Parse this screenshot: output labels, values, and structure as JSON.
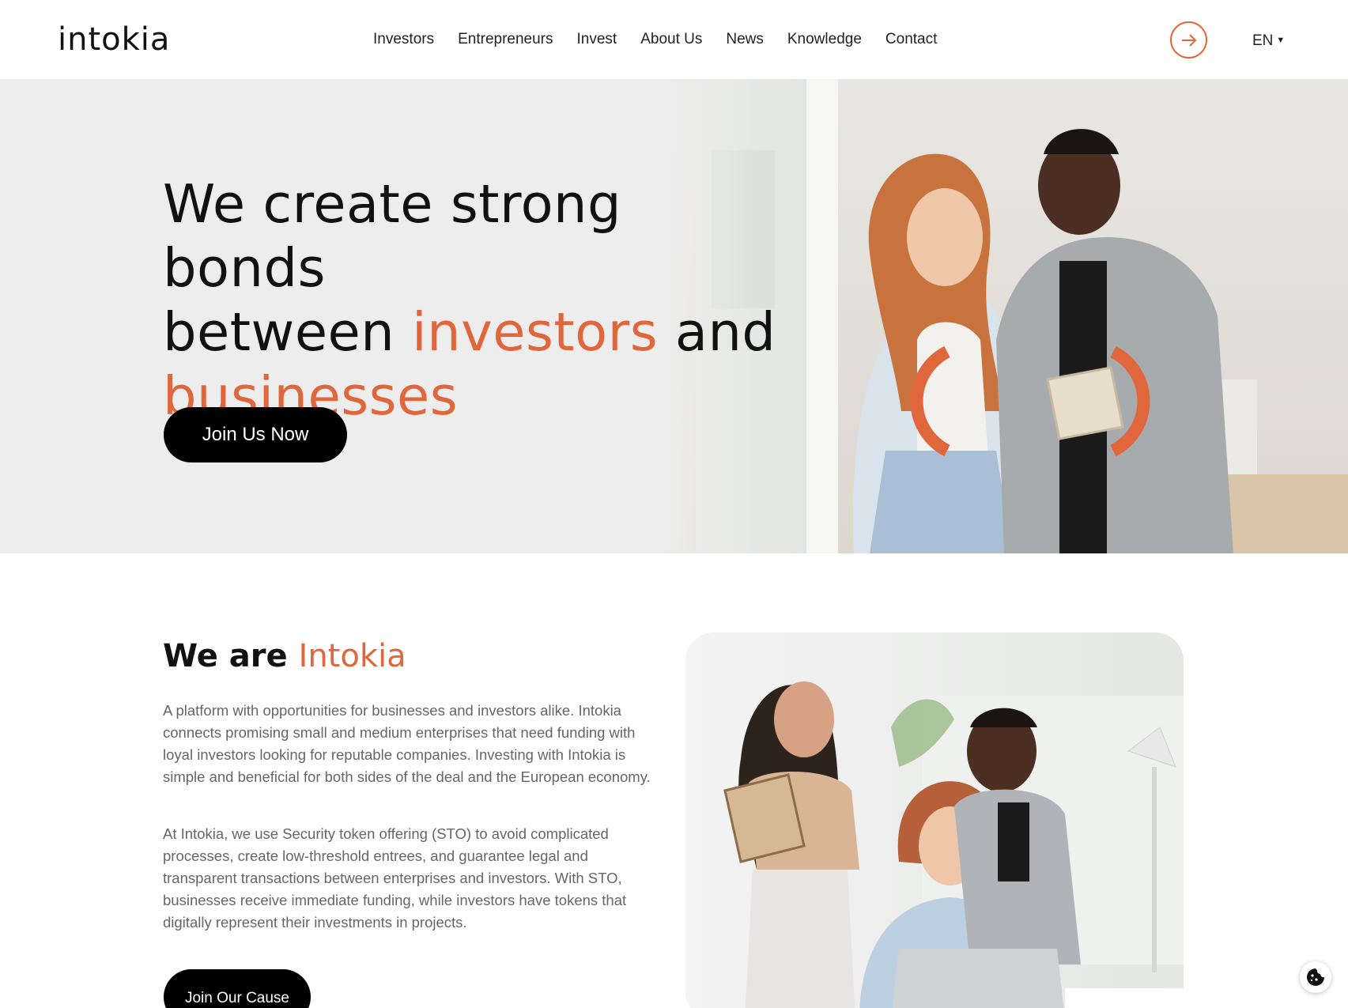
{
  "header": {
    "logo": "intokia",
    "nav": [
      "Investors",
      "Entrepreneurs",
      "Invest",
      "About Us",
      "News",
      "Knowledge",
      "Contact"
    ],
    "language": "EN",
    "login_icon": "arrow-right-circle-icon"
  },
  "hero": {
    "title_line1": "We create strong bonds",
    "title_line2_a": "between ",
    "title_line2_accent": "investors",
    "title_line2_b": " and",
    "title_line3_accent": "businesses",
    "cta_label": "Join Us Now"
  },
  "about": {
    "title_a": "We are ",
    "title_accent": "Intokia",
    "paragraph1": "A platform with opportunities for businesses and investors alike. Intokia connects promising small and medium enterprises that need funding with loyal investors looking for reputable companies. Investing with Intokia is simple and beneficial for both sides of the deal and the European economy.",
    "paragraph2": "At Intokia, we use Security token offering (STO) to avoid complicated processes, create low-threshold entrees, and guarantee legal and transparent transactions between enterprises and investors. With STO, businesses receive immediate funding, while investors have tokens that digitally represent their investments in projects.",
    "cta_label": "Join Our Cause"
  },
  "colors": {
    "accent": "#e0663c",
    "hero_bg": "#ededed",
    "button_bg": "#000000"
  },
  "cookie_icon": "cookie-icon"
}
